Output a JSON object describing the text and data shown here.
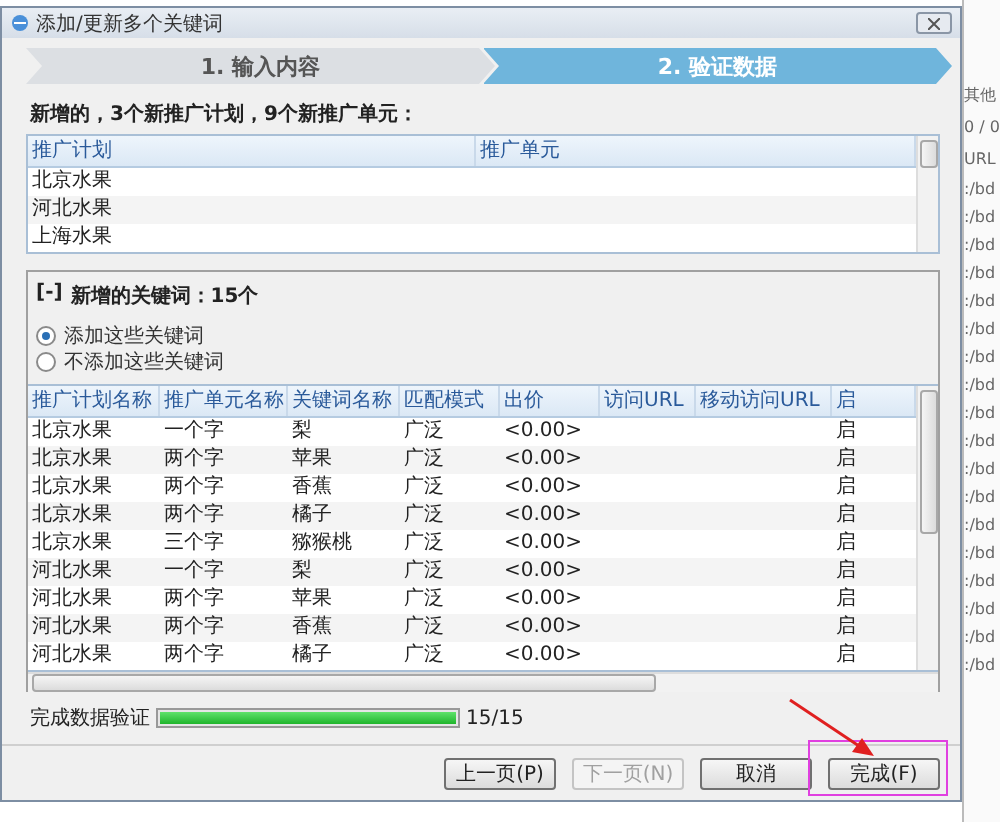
{
  "window": {
    "title": "添加/更新多个关键词"
  },
  "steps": [
    {
      "label": "1. 输入内容",
      "selected": false
    },
    {
      "label": "2. 验证数据",
      "selected": true
    }
  ],
  "summary": "新增的，3个新推广计划，9个新推广单元：",
  "plan_table": {
    "columns": [
      "推广计划",
      "推广单元"
    ],
    "rows": [
      [
        "北京水果",
        ""
      ],
      [
        "河北水果",
        ""
      ],
      [
        "上海水果",
        ""
      ]
    ]
  },
  "keyword_section": {
    "toggle": "[-]",
    "title": "新增的关键词：15个",
    "options": [
      {
        "label": "添加这些关键词",
        "selected": true
      },
      {
        "label": "不添加这些关键词",
        "selected": false
      }
    ],
    "columns": [
      "推广计划名称",
      "推广单元名称",
      "关键词名称",
      "匹配模式",
      "出价",
      "访问URL",
      "移动访问URL",
      "启"
    ],
    "rows": [
      [
        "北京水果",
        "一个字",
        "梨",
        "广泛",
        "<0.00>",
        "",
        "",
        "启"
      ],
      [
        "北京水果",
        "两个字",
        "苹果",
        "广泛",
        "<0.00>",
        "",
        "",
        "启"
      ],
      [
        "北京水果",
        "两个字",
        "香蕉",
        "广泛",
        "<0.00>",
        "",
        "",
        "启"
      ],
      [
        "北京水果",
        "两个字",
        "橘子",
        "广泛",
        "<0.00>",
        "",
        "",
        "启"
      ],
      [
        "北京水果",
        "三个字",
        "猕猴桃",
        "广泛",
        "<0.00>",
        "",
        "",
        "启"
      ],
      [
        "河北水果",
        "一个字",
        "梨",
        "广泛",
        "<0.00>",
        "",
        "",
        "启"
      ],
      [
        "河北水果",
        "两个字",
        "苹果",
        "广泛",
        "<0.00>",
        "",
        "",
        "启"
      ],
      [
        "河北水果",
        "两个字",
        "香蕉",
        "广泛",
        "<0.00>",
        "",
        "",
        "启"
      ],
      [
        "河北水果",
        "两个字",
        "橘子",
        "广泛",
        "<0.00>",
        "",
        "",
        "启"
      ]
    ]
  },
  "progress": {
    "label": "完成数据验证",
    "level": 1,
    "reading": "15/15"
  },
  "buttons": [
    {
      "label": "上一页(P)",
      "disabled": false
    },
    {
      "label": "下一页(N)",
      "disabled": true
    },
    {
      "label": "取消",
      "disabled": false
    },
    {
      "label": "完成(F)",
      "disabled": false
    }
  ],
  "background": {
    "labels": [
      "其他",
      "0 / 0",
      "URL"
    ],
    "rows": [
      ":/bd",
      ":/bd",
      ":/bd",
      ":/bd",
      ":/bd",
      ":/bd",
      ":/bd",
      ":/bd",
      ":/bd",
      ":/bd",
      ":/bd",
      ":/bd",
      ":/bd",
      ":/bd",
      ":/bd",
      ":/bd",
      ":/bd",
      ":/bd"
    ]
  }
}
